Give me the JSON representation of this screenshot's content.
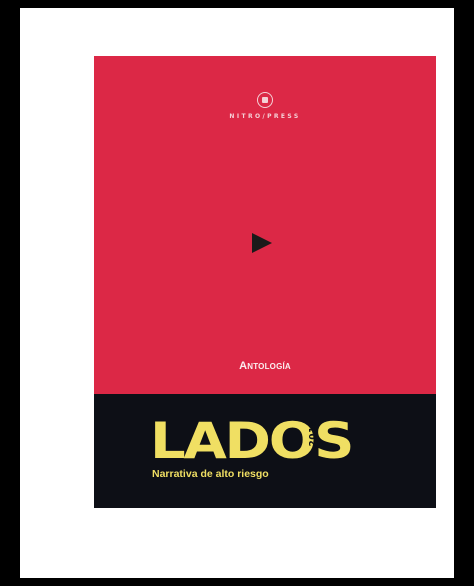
{
  "cover": {
    "publisher": "NITRO/PRESS",
    "label": "Antología",
    "title": "LADOS",
    "year": "2018",
    "subtitle": "Narrativa de alto riesgo"
  },
  "colors": {
    "cover_red": "#dc2846",
    "band_dark": "#0d0f16",
    "title_yellow": "#f0df63",
    "frame_black": "#000000"
  },
  "icons": {
    "publisher": "publisher-logo-icon",
    "mark": "play-triangle-icon"
  }
}
